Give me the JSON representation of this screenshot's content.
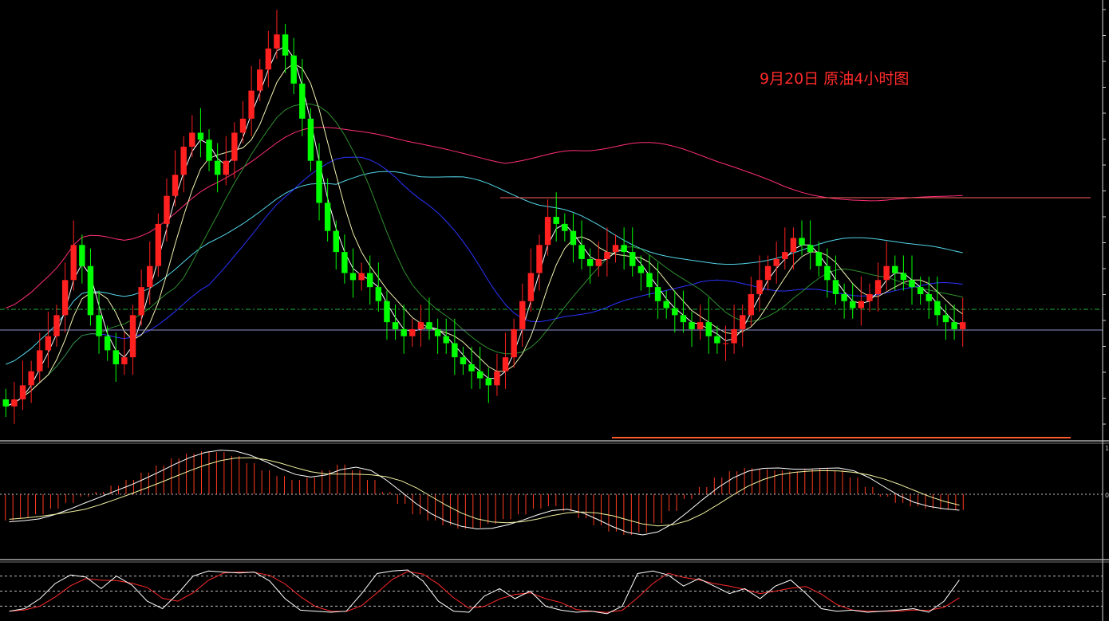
{
  "title": "9月20日 原油4小时图",
  "colors": {
    "background": "#000000",
    "bull_candle": "#ff2020",
    "bear_candle": "#00ff00",
    "ma_fast": "#ffffff",
    "ma_slow": "#f2f2b0",
    "ma_mid": "#2f8f2f",
    "ma_blue": "#2a33ff",
    "ma_cyan": "#53d6e8",
    "ma_long": "#ff2e78",
    "resistance_line": "#ff6060",
    "support_line": "#ff5a2a",
    "current_price_line": "#8f8fcf",
    "reference_dashed_line": "#1faf3a",
    "macd_histogram": "#ff3a1f",
    "kd_k": "#ffffff",
    "kd_d": "#ff2a2a",
    "separator": "#ffffff"
  },
  "chart_data": [
    {
      "type": "candlestick",
      "panel": "price",
      "series": [
        {
          "name": "",
          "kind": "candles",
          "open": [
            38,
            37,
            38,
            40,
            42,
            45,
            47,
            50,
            55,
            60,
            57,
            50,
            47,
            45,
            43,
            44,
            50,
            54,
            57,
            63,
            67,
            70,
            74,
            76,
            75,
            72,
            70,
            72,
            76,
            78,
            82,
            85,
            88,
            90,
            87,
            83,
            78,
            72,
            66,
            62,
            59,
            56,
            55,
            56,
            54,
            52,
            49,
            48,
            47,
            48,
            49,
            48,
            47,
            46,
            44,
            43,
            42,
            41,
            40,
            42,
            44,
            48,
            52,
            56,
            60,
            64,
            63,
            62,
            60,
            58,
            57,
            58,
            59,
            60,
            59,
            57,
            56,
            54,
            52,
            51,
            50,
            49,
            48,
            49,
            47,
            46,
            46,
            48,
            50,
            53,
            55,
            57,
            58,
            59,
            61,
            60,
            59,
            57,
            55,
            53,
            52,
            51,
            52,
            53,
            55,
            57,
            56,
            55,
            54,
            53,
            52,
            50,
            49,
            48
          ],
          "close": [
            37,
            38,
            40,
            42,
            45,
            47,
            50,
            55,
            60,
            57,
            50,
            47,
            45,
            43,
            44,
            50,
            54,
            57,
            63,
            67,
            70,
            74,
            76,
            75,
            72,
            70,
            72,
            76,
            78,
            82,
            85,
            88,
            90,
            87,
            83,
            78,
            72,
            66,
            62,
            59,
            56,
            55,
            56,
            54,
            52,
            49,
            48,
            47,
            48,
            49,
            48,
            47,
            46,
            44,
            43,
            42,
            41,
            40,
            42,
            44,
            48,
            52,
            56,
            60,
            64,
            63,
            62,
            60,
            58,
            57,
            58,
            59,
            60,
            59,
            57,
            56,
            54,
            52,
            51,
            50,
            49,
            48,
            49,
            47,
            46,
            46,
            48,
            50,
            53,
            55,
            57,
            58,
            59,
            61,
            60,
            59,
            57,
            55,
            53,
            52,
            51,
            52,
            53,
            55,
            57,
            56,
            55,
            54,
            53,
            52,
            50,
            49,
            48,
            49
          ]
        },
        {
          "name": "",
          "kind": "moving_average",
          "period_role": "fast"
        },
        {
          "name": "",
          "kind": "moving_average",
          "period_role": "slow"
        },
        {
          "name": "",
          "kind": "moving_average",
          "period_role": "mid"
        },
        {
          "name": "",
          "kind": "moving_average",
          "period_role": "blue"
        },
        {
          "name": "",
          "kind": "moving_average",
          "period_role": "cyan"
        },
        {
          "name": "",
          "kind": "moving_average",
          "period_role": "long"
        }
      ],
      "horizontal_lines": [
        {
          "role": "resistance",
          "style": "solid"
        },
        {
          "role": "support",
          "style": "solid"
        },
        {
          "role": "current_price",
          "style": "solid"
        },
        {
          "role": "reference",
          "style": "dash-dot"
        }
      ],
      "grid": false,
      "legend": "none"
    },
    {
      "type": "bar",
      "panel": "macd",
      "y_tick_labels": [
        "1",
        "0"
      ],
      "series": [
        {
          "name": "",
          "kind": "histogram",
          "values": [
            -0.55,
            -0.5,
            -0.42,
            -0.3,
            -0.18,
            -0.05,
            0.05,
            0.18,
            0.3,
            0.45,
            0.6,
            0.75,
            0.85,
            0.9,
            0.88,
            0.8,
            0.65,
            0.5,
            0.38,
            0.3,
            0.35,
            0.5,
            0.62,
            0.5,
            0.3,
            0.05,
            -0.2,
            -0.42,
            -0.55,
            -0.65,
            -0.72,
            -0.7,
            -0.62,
            -0.52,
            -0.42,
            -0.3,
            -0.25,
            -0.35,
            -0.5,
            -0.65,
            -0.78,
            -0.85,
            -0.8,
            -0.6,
            -0.35,
            -0.1,
            0.15,
            0.35,
            0.48,
            0.55,
            0.52,
            0.5,
            0.48,
            0.52,
            0.55,
            0.5,
            0.35,
            0.15,
            -0.05,
            -0.18,
            -0.25,
            -0.3,
            -0.32,
            -0.33
          ]
        },
        {
          "name": "",
          "kind": "signal_line"
        }
      ],
      "grid": false
    },
    {
      "type": "line",
      "panel": "kd",
      "series": [
        {
          "name": "",
          "kind": "k_line",
          "values": [
            0.1,
            0.15,
            0.35,
            0.65,
            0.82,
            0.78,
            0.55,
            0.8,
            0.62,
            0.3,
            0.15,
            0.45,
            0.8,
            0.9,
            0.88,
            0.86,
            0.88,
            0.7,
            0.35,
            0.12,
            0.1,
            0.08,
            0.1,
            0.45,
            0.85,
            0.9,
            0.92,
            0.7,
            0.3,
            0.1,
            0.08,
            0.4,
            0.55,
            0.35,
            0.5,
            0.2,
            0.12,
            0.08,
            0.1,
            0.05,
            0.2,
            0.85,
            0.9,
            0.82,
            0.6,
            0.75,
            0.6,
            0.45,
            0.55,
            0.35,
            0.6,
            0.72,
            0.45,
            0.15,
            0.1,
            0.12,
            0.08,
            0.1,
            0.12,
            0.15,
            0.08,
            0.3,
            0.72
          ]
        },
        {
          "name": "",
          "kind": "d_line"
        }
      ],
      "reference_levels": [
        0.2,
        0.5,
        0.8
      ],
      "grid": false
    }
  ]
}
